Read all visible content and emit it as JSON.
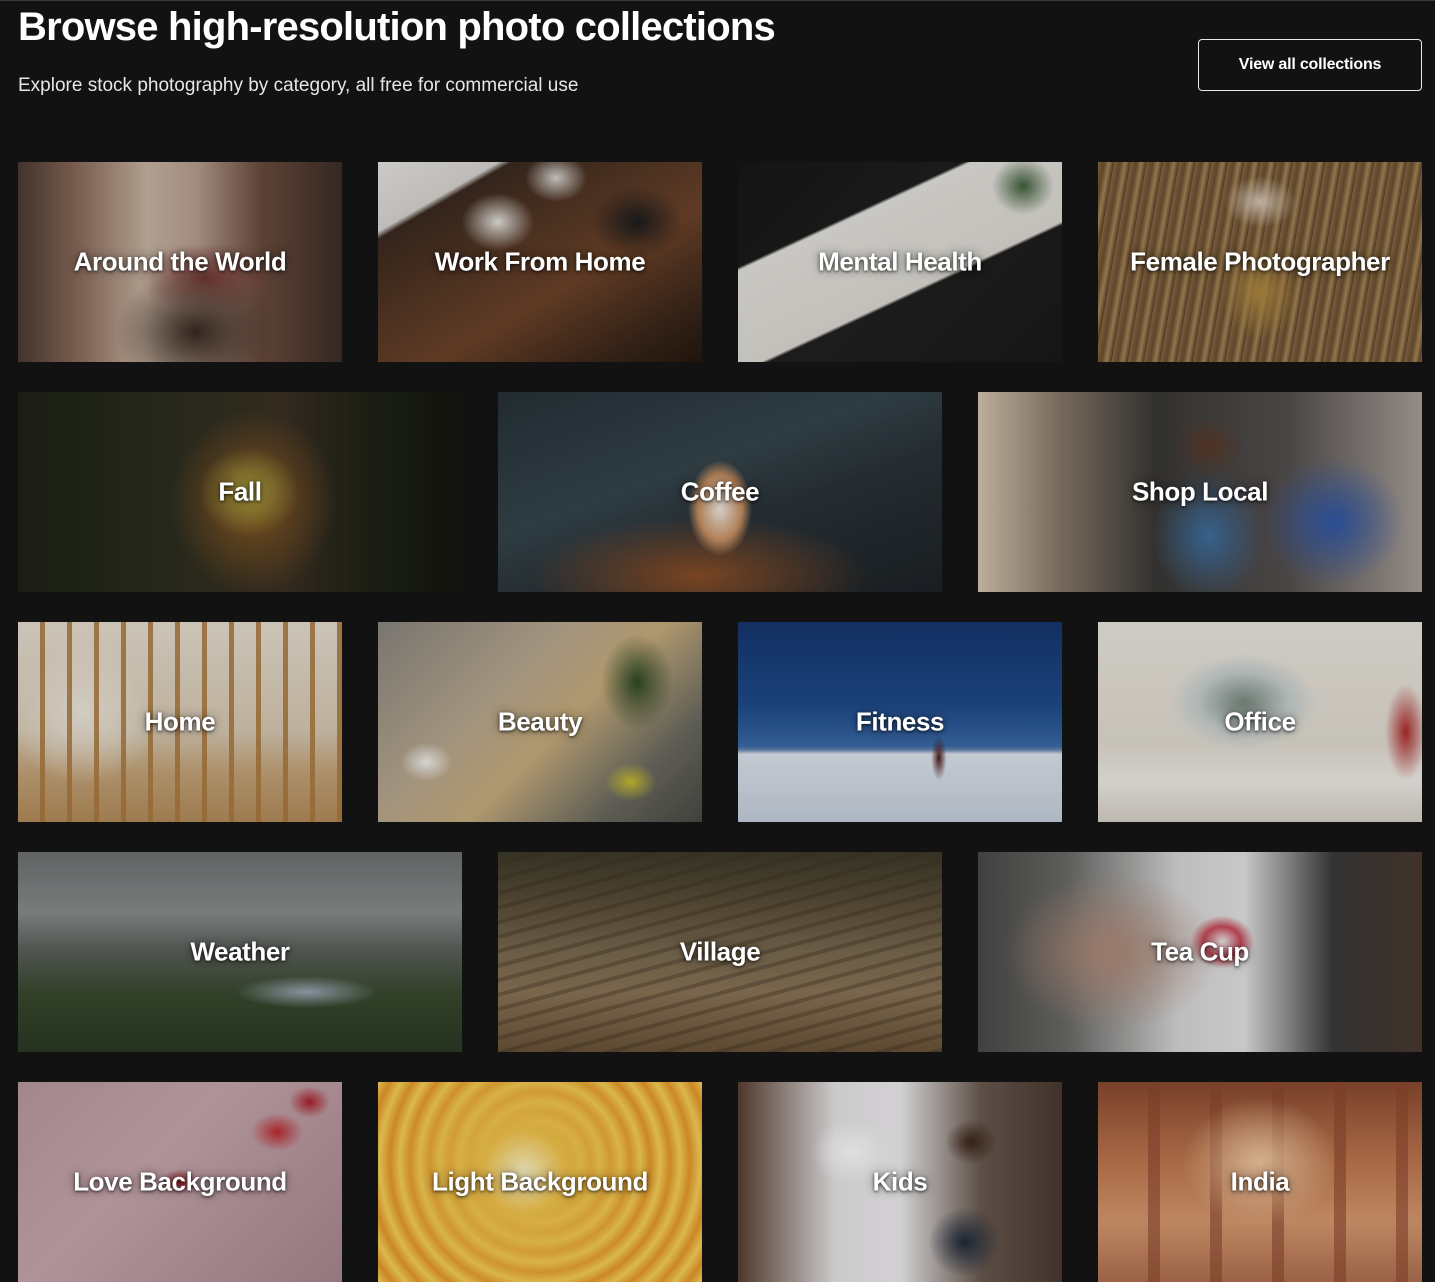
{
  "header": {
    "title": "Browse high-resolution photo collections",
    "subtitle": "Explore stock photography by category, all free for commercial use",
    "view_all_label": "View all collections"
  },
  "collections": [
    {
      "label": "Around the World",
      "accent": "#8a6a5a"
    },
    {
      "label": "Work From Home",
      "accent": "#5a3a26"
    },
    {
      "label": "Mental Health",
      "accent": "#1a1a1a"
    },
    {
      "label": "Female Photographer",
      "accent": "#8a6a45"
    },
    {
      "label": "Fall",
      "accent": "#8a5a22"
    },
    {
      "label": "Coffee",
      "accent": "#35454c"
    },
    {
      "label": "Shop Local",
      "accent": "#3d6fa0"
    },
    {
      "label": "Home",
      "accent": "#d8c9b2"
    },
    {
      "label": "Beauty",
      "accent": "#b8a890"
    },
    {
      "label": "Fitness",
      "accent": "#1e4a8a"
    },
    {
      "label": "Office",
      "accent": "#e2ddd2"
    },
    {
      "label": "Weather",
      "accent": "#5a605a"
    },
    {
      "label": "Village",
      "accent": "#7a6a50"
    },
    {
      "label": "Tea Cup",
      "accent": "#d8d8d8"
    },
    {
      "label": "Love Background",
      "accent": "#c8a8ae"
    },
    {
      "label": "Light Background",
      "accent": "#f3c44a"
    },
    {
      "label": "Kids",
      "accent": "#e8e6e8"
    },
    {
      "label": "India",
      "accent": "#c07850"
    }
  ],
  "colors": {
    "background": "#121212",
    "text": "#ffffff",
    "button_border": "#e8e8e8"
  }
}
